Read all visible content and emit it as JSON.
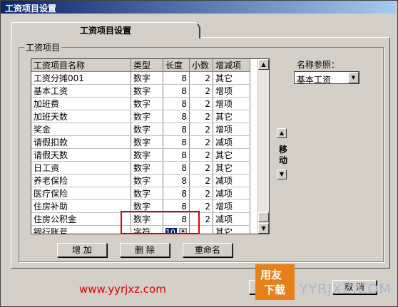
{
  "window": {
    "title": "工资项目设置"
  },
  "tab": {
    "label": "工资项目设置"
  },
  "group": {
    "label": "工资项目"
  },
  "grid": {
    "columns": [
      "工资项目名称",
      "类型",
      "长度",
      "小数",
      "增减项"
    ],
    "rows": [
      [
        "工资分摊001",
        "数字",
        "8",
        "2",
        "其它"
      ],
      [
        "基本工资",
        "数字",
        "8",
        "2",
        "增项"
      ],
      [
        "加班费",
        "数字",
        "8",
        "2",
        "增项"
      ],
      [
        "加班天数",
        "数字",
        "8",
        "2",
        "其它"
      ],
      [
        "奖金",
        "数字",
        "8",
        "2",
        "增项"
      ],
      [
        "请假扣款",
        "数字",
        "8",
        "2",
        "减项"
      ],
      [
        "请假天数",
        "数字",
        "8",
        "2",
        "其它"
      ],
      [
        "日工资",
        "数字",
        "8",
        "2",
        "其它"
      ],
      [
        "养老保险",
        "数字",
        "8",
        "2",
        "减项"
      ],
      [
        "医疗保险",
        "数字",
        "8",
        "2",
        "减项"
      ],
      [
        "住房补助",
        "数字",
        "8",
        "2",
        "增项"
      ],
      [
        "住房公积金",
        "数字",
        "8",
        "2",
        "减项"
      ]
    ],
    "edit_row": {
      "name": "银行账号",
      "type": "字符",
      "length": "10",
      "decimals": "",
      "inc_dec": "其它"
    }
  },
  "buttons": {
    "add": "增 加",
    "delete": "删 除",
    "rename": "重命名",
    "cancel": "取 消"
  },
  "reference": {
    "label": "名称参照：",
    "value": "基本工资"
  },
  "move": {
    "label": "移动"
  },
  "watermark": {
    "url": "www.yyrjxz.com",
    "logo_top": "用友",
    "logo_bottom": "下载",
    "brand": "YYRJXZ.COM"
  },
  "colors": {
    "highlight": "#e00000",
    "selection": "#0a246a"
  }
}
